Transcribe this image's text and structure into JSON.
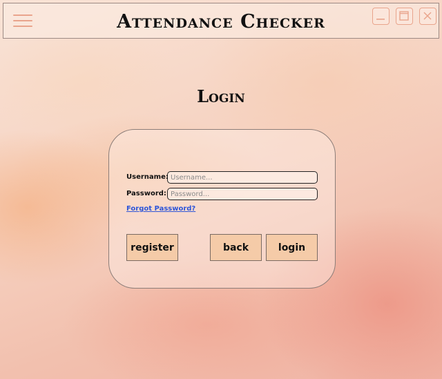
{
  "app": {
    "title": "Attendance Checker"
  },
  "window_controls": {
    "menu_icon": "hamburger-menu-icon",
    "minimize_icon": "minimize-icon",
    "maximize_icon": "maximize-icon",
    "close_icon": "close-icon"
  },
  "page": {
    "heading": "Login"
  },
  "form": {
    "username": {
      "label": "Username:",
      "value": "",
      "placeholder": "Username..."
    },
    "password": {
      "label": "Password:",
      "value": "",
      "placeholder": "Password..."
    },
    "forgot_password": "Forgot Password?"
  },
  "buttons": {
    "register": "register",
    "back": "back",
    "login": "login"
  },
  "colors": {
    "accent_icon": "#e9a48c",
    "button_bg": "#f5cba8",
    "link": "#2d55d8",
    "background": "#f6d3c2"
  }
}
